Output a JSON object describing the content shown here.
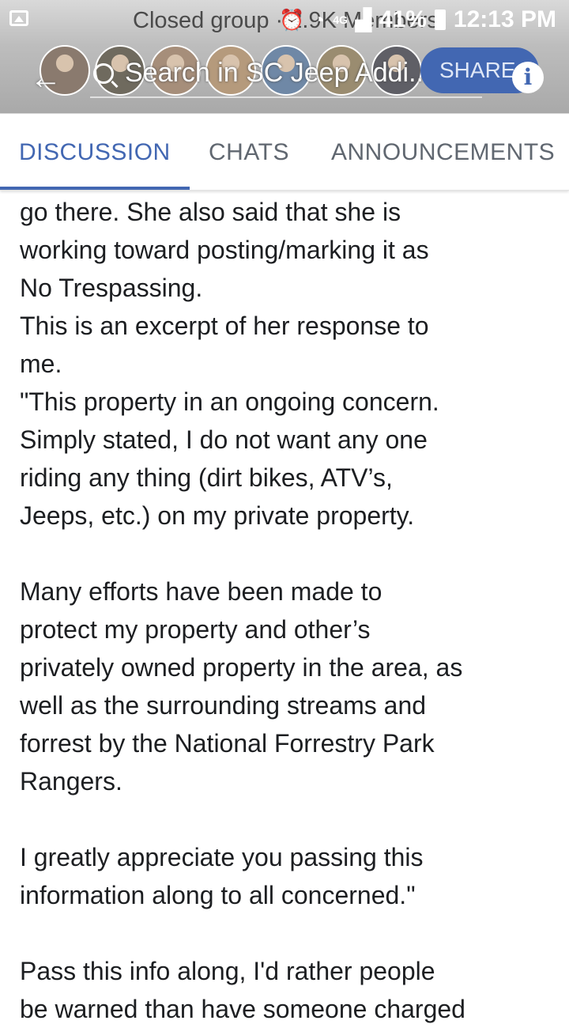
{
  "status_bar": {
    "behind_text": "Closed group · 2.9K Members",
    "network": "4G",
    "battery": "41%",
    "time": "12:13 PM"
  },
  "header": {
    "search_text": "Search in SC Jeep Addi...",
    "share_label": "SHARE",
    "info_label": "i",
    "avatar_count": 7,
    "avatar_colors": [
      "#8a7a6e",
      "#6f6a5e",
      "#a68e7a",
      "#b59a7c",
      "#6f88a6",
      "#9a8c70",
      "#5f5f66"
    ]
  },
  "tabs": [
    {
      "label": "DISCUSSION",
      "active": true
    },
    {
      "label": "CHATS",
      "active": false
    },
    {
      "label": "ANNOUNCEMENTS",
      "active": false
    }
  ],
  "post": {
    "lines": [
      "go there. She also said that she is",
      "working toward posting/marking it as",
      "No Trespassing.",
      "This is an excerpt of her response to",
      "me.",
      "\"This property in an ongoing concern.",
      "Simply stated, I do not want any one",
      "riding any thing (dirt bikes, ATV’s,",
      "Jeeps, etc.) on my private property.",
      "",
      "Many efforts have been made to",
      "protect my property and other’s",
      "privately owned property in the area, as",
      "well as the surrounding streams and",
      "forrest by the National Forrestry Park",
      "Rangers.",
      "",
      "I greatly appreciate you passing this",
      "information along to all concerned.\"",
      "",
      "Pass this info along, I'd rather people",
      "be warned than have someone charged"
    ]
  },
  "colors": {
    "accent": "#4267b2",
    "tab_inactive": "#606770",
    "text": "#1c1e21"
  }
}
